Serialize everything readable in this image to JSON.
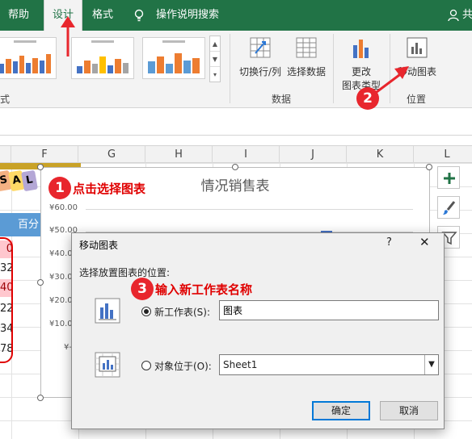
{
  "tabs": {
    "help": "帮助",
    "design": "设计",
    "format": "格式",
    "tell_me": "操作说明搜索",
    "share": "共"
  },
  "ribbon": {
    "switch_row_col": "切换行/列",
    "select_data": "选择数据",
    "data_group": "数据",
    "change_chart_type_1": "更改",
    "change_chart_type_2": "图表类型",
    "move_chart": "移动图表",
    "location_group": "位置",
    "left_group_label": "式"
  },
  "sheet": {
    "columns": [
      "F",
      "G",
      "H",
      "I",
      "J",
      "K",
      "L"
    ],
    "sal_letters": [
      "S",
      "A",
      "L"
    ],
    "percent_header": "百分",
    "numbers": [
      "0",
      "32",
      "40",
      "22",
      "34",
      "78"
    ],
    "pink_rows": [
      0,
      2
    ]
  },
  "chart": {
    "title": "情况销售表",
    "y_ticks": [
      "¥60.00",
      "¥50.00",
      "¥40.00",
      "¥30.00",
      "¥20.00",
      "¥10.00",
      "¥-"
    ]
  },
  "annotations": {
    "step1_num": "1",
    "step1_text": "点击选择图表",
    "step2_num": "2",
    "step3_num": "3",
    "step3_text": "输入新工作表名称"
  },
  "dialog": {
    "title": "移动图表",
    "help": "?",
    "close": "✕",
    "prompt": "选择放置图表的位置:",
    "new_sheet_label": "新工作表(S):",
    "new_sheet_value": "图表",
    "object_in_label": "对象位于(O):",
    "object_in_value": "Sheet1",
    "ok": "确定",
    "cancel": "取消"
  },
  "colors": {
    "excel_green": "#217346",
    "annotation_red": "#e8262d",
    "accent_blue": "#0078d7"
  }
}
